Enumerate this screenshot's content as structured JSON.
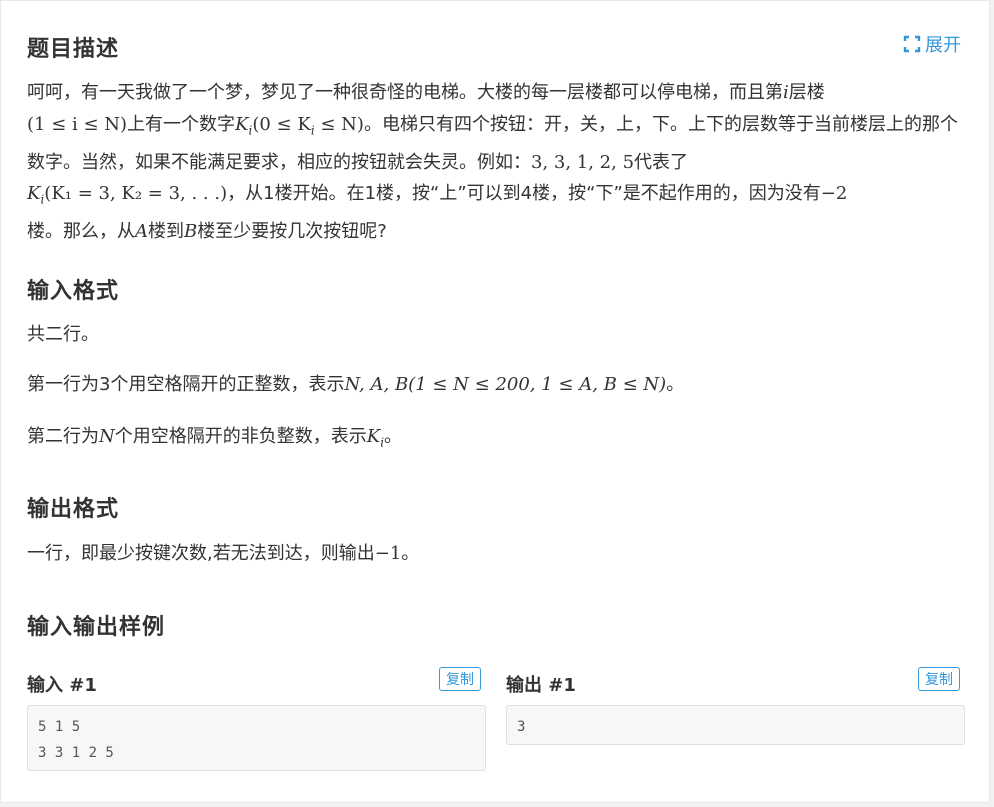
{
  "problem": {
    "title": "题目描述",
    "expand_label": "展开",
    "description": {
      "t1": "呵呵，有一天我做了一个梦，梦见了一种很奇怪的电梯。大楼的每一层楼都可以停电梯，而且第",
      "var_i": "i",
      "t2": "层楼",
      "cond1": "(1 ≤ i ≤ N)",
      "t3": "上有一个数字",
      "ki": "K",
      "ki_sub": "i",
      "cond2": "(0 ≤ K",
      "cond2_sub": "i",
      "cond2_end": " ≤ N)",
      "t4": "。电梯只有四个按钮：开，关，上，下。上下的层数等于当前楼层上的那个数字。当然，如果不能满足要求，相应的按钮就会失灵。例如：",
      "example_seq": "3, 3, 1, 2, 5",
      "t5": "代表了",
      "ki2": "K",
      "ki2_sub": "i",
      "example_def": "(K₁ = 3, K₂ = 3, . . .)",
      "t6": "，从1楼开始。在1楼，按“上”可以到4楼，按“下”是不起作用的，因为没有",
      "neg2": "−2",
      "t7": "楼。那么，从",
      "var_a": "A",
      "t8": "楼到",
      "var_b": "B",
      "t9": "楼至少要按几次按钮呢?"
    }
  },
  "input_format": {
    "title": "输入格式",
    "line1": "共二行。",
    "line2_pre": "第一行为3个用空格隔开的正整数，表示",
    "line2_math": "N, A, B(1 ≤ N ≤ 200, 1 ≤ A, B ≤ N)",
    "line2_post": "。",
    "line3_pre": "第二行为",
    "line3_var": "N",
    "line3_mid": "个用空格隔开的非负整数，表示",
    "line3_k": "K",
    "line3_k_sub": "i",
    "line3_post": "。"
  },
  "output_format": {
    "title": "输出格式",
    "line1_pre": "一行，即最少按键次数,若无法到达，则输出",
    "line1_math": "−1",
    "line1_post": "。"
  },
  "samples": {
    "title": "输入输出样例",
    "input_label": "输入 #1",
    "output_label": "输出 #1",
    "copy_label": "复制",
    "input_text": "5 1 5\n3 3 1 2 5",
    "output_text": "3"
  }
}
